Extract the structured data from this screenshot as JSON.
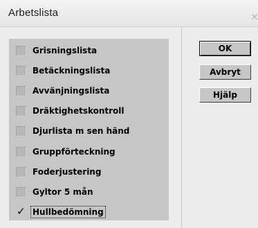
{
  "window": {
    "title": "Arbetslista",
    "close_symbol": "×"
  },
  "list": {
    "items": [
      {
        "label": "Grisningslista",
        "checked": false,
        "focused": false
      },
      {
        "label": "Betäckningslista",
        "checked": false,
        "focused": false
      },
      {
        "label": "Avvänjningslista",
        "checked": false,
        "focused": false
      },
      {
        "label": "Dräktighetskontroll",
        "checked": false,
        "focused": false
      },
      {
        "label": "Djurlista m sen händ",
        "checked": false,
        "focused": false
      },
      {
        "label": "Gruppförteckning",
        "checked": false,
        "focused": false
      },
      {
        "label": "Foderjustering",
        "checked": false,
        "focused": false
      },
      {
        "label": "Gyltor 5 mån",
        "checked": false,
        "focused": false
      },
      {
        "label": "Hullbedömning",
        "checked": true,
        "focused": true
      }
    ],
    "check_symbol": "✓"
  },
  "buttons": {
    "ok": "OK",
    "cancel": "Avbryt",
    "help": "Hjälp"
  },
  "icons": {
    "close": "close-icon",
    "checkmark": "checkmark-icon"
  },
  "colors": {
    "panel": "#c6c6c6",
    "window": "#ececec"
  }
}
